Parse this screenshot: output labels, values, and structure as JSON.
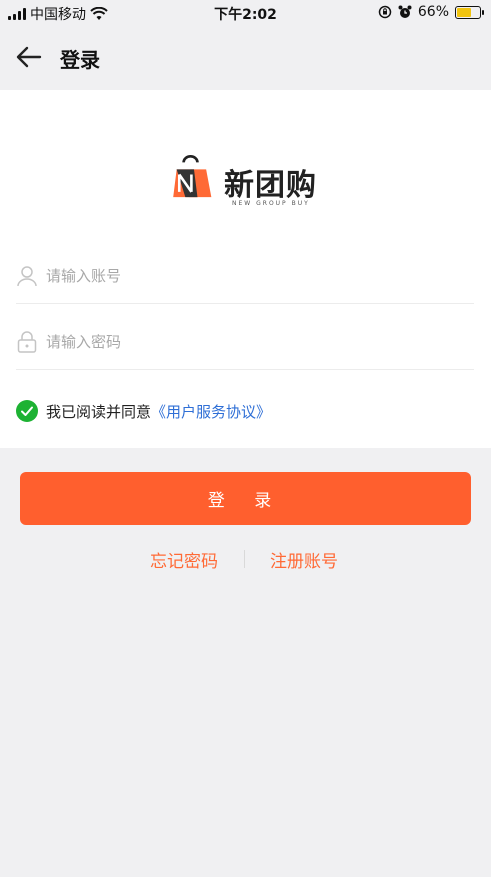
{
  "status_bar": {
    "carrier": "中国移动",
    "time": "下午2:02",
    "battery_percent": "66%",
    "battery_level": 0.66
  },
  "nav": {
    "title": "登录"
  },
  "logo": {
    "text": "新团购",
    "subtext": "NEW GROUP BUY"
  },
  "form": {
    "account_placeholder": "请输入账号",
    "password_placeholder": "请输入密码",
    "agree_text": "我已阅读并同意",
    "agree_link": "《用户服务协议》",
    "agree_checked": true
  },
  "actions": {
    "login_label": "登 录",
    "forgot_label": "忘记密码",
    "register_label": "注册账号"
  },
  "colors": {
    "primary": "#ff5f2e",
    "link_blue": "#2f6fd6",
    "check_green": "#1db233"
  }
}
